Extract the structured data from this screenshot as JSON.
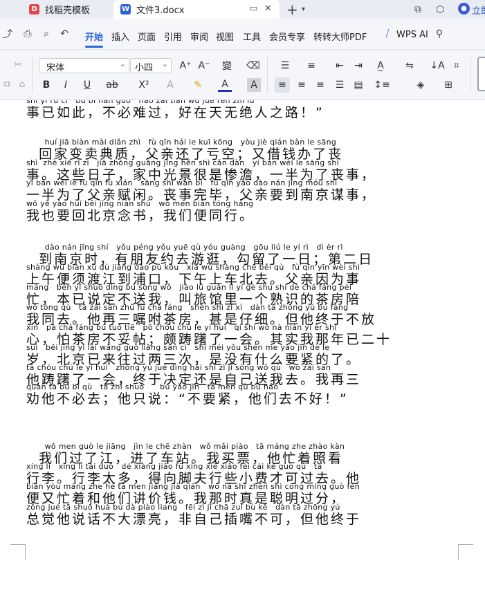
{
  "tabs": [
    {
      "label": "找稻壳模板",
      "logo": "D"
    },
    {
      "label": "文件3.docx",
      "logo": "W"
    }
  ],
  "titlebar": {
    "new_tab": "+",
    "user_label": "立即"
  },
  "menu": {
    "items": [
      "开始",
      "插入",
      "页面",
      "引用",
      "审阅",
      "视图",
      "工具",
      "会员专享",
      "转转大师PDF",
      "WPS AI"
    ]
  },
  "ribbon": {
    "font_name": "宋体",
    "font_size": "小四",
    "font_color": "#e02020"
  },
  "document": {
    "lines": [
      {
        "py": "shì yǐ rú cǐ   bú bì nán guò   hǎo zài tiān wú jué rén zhī lù",
        "hz": "事已如此，不必难过，好在天无绝人之路！”"
      },
      {
        "py": "",
        "hz": ""
      },
      {
        "py": "       huí jiā biàn mài diǎn zhì   fù qīn hái le kuī kōng   yòu jiè qián bàn le sāng",
        "hz": "  回家变卖典质，父亲还了亏空；又借钱办了丧"
      },
      {
        "py": "shì  zhè xiē rì zi   jiā zhōng guāng jǐng hěn shì cǎn dàn   yí bàn wèi le sāng shì",
        "hz": "事。这些日子，家中光景很是惨澹，一半为了丧事，"
      },
      {
        "py": "yí bàn wèi le fù qīn fù xián   sāng shì wán bì   fù qīn yào dào nán jīng móu shì",
        "hz": "一半为了父亲赋闲。丧事完毕，父亲要到南京谋事，"
      },
      {
        "py": "wǒ yě yào huí běi jīng niàn shū   wǒ men biàn tóng háng",
        "hz": "我也要回北京念书，我们便同行。"
      },
      {
        "py": "",
        "hz": ""
      },
      {
        "py": "       dào nán jīng shí   yǒu péng yǒu yuē qù yóu guàng   gōu liú le yí rì   dì èr rì",
        "hz": "  到南京时，有朋友约去游逛，勾留了一日；第二日"
      },
      {
        "py": "shàng wǔ biàn xū dù jiāng dào pǔ kǒu   xià wǔ shàng chē běi qù   fù qīn yīn wèi shì",
        "hz": "上午便须渡江到浦口，下午上车北去。父亲因为事"
      },
      {
        "py": "máng   běn yǐ shuō dìng bú sòng wǒ   jiào lǚ guǎn lǐ yí gè shú shí de chá fáng péi",
        "hz": "忙，本已说定不送我，叫旅馆里一个熟识的茶房陪"
      },
      {
        "py": "wǒ tóng qù   tā zài sān zhǔ fù chá fáng   shèn shì zǐ xì   dàn tā zhōng yú bú fàng",
        "hz": "我同去。他再三嘱咐茶房，甚是仔细。但他终于不放"
      },
      {
        "py": "xīn   pà chá fáng bú tuǒ tiē   pō chóu chú le yí huì   qí shí wǒ nà nián yǐ èr shí",
        "hz": "心，怕茶房不妥帖；颇踌躇了一会。其实我那年已二十"
      },
      {
        "py": "suì   běi jīng yǐ lái wǎng guò liǎng sān cì   shì méi yǒu shén me yào jǐn de le",
        "hz": "岁，北京已来往过两三次，是没有什么要紧的了。"
      },
      {
        "py": "tā chóu chú le yí huì   zhōng yú jué dìng hái shì zì jǐ sòng wǒ qù   wǒ zài sān",
        "hz": "他踌躇了一会，终于决定还是自己送我去。我再三"
      },
      {
        "py": "quàn tā bú bì qù   tā zhǐ shuō      bú yào jǐn   tā men qù bù hǎo",
        "hz": "劝他不必去；他只说：“不要紧，他们去不好！”"
      },
      {
        "py": "",
        "hz": ""
      },
      {
        "py": "       wǒ men guò le jiāng   jìn le chē zhàn   wǒ mǎi piào   tā máng zhe zhào kàn",
        "hz": "  我们过了江，进了车站。我买票，他忙着照看"
      },
      {
        "py": "xíng li   xíng li tài duō   dé xiàng jiǎo fū xíng xiē xiǎo fèi cái kě guò qù   tā",
        "hz": "行李。行李太多，得向脚夫行些小费才可过去。他"
      },
      {
        "py": "biàn yòu máng zhe hé tā men jiǎng jià qián   wǒ nà shí zhēn shì cōng míng guò fèn",
        "hz": "便又忙着和他们讲价钱。我那时真是聪明过分，"
      },
      {
        "py": "zǒng jué tā shuō huà bú dà piào liang   fēi zì jǐ chā zuǐ bù kě   dàn tā zhōng yú",
        "hz": "总觉他说话不大漂亮，非自己插嘴不可，但他终于"
      }
    ]
  }
}
